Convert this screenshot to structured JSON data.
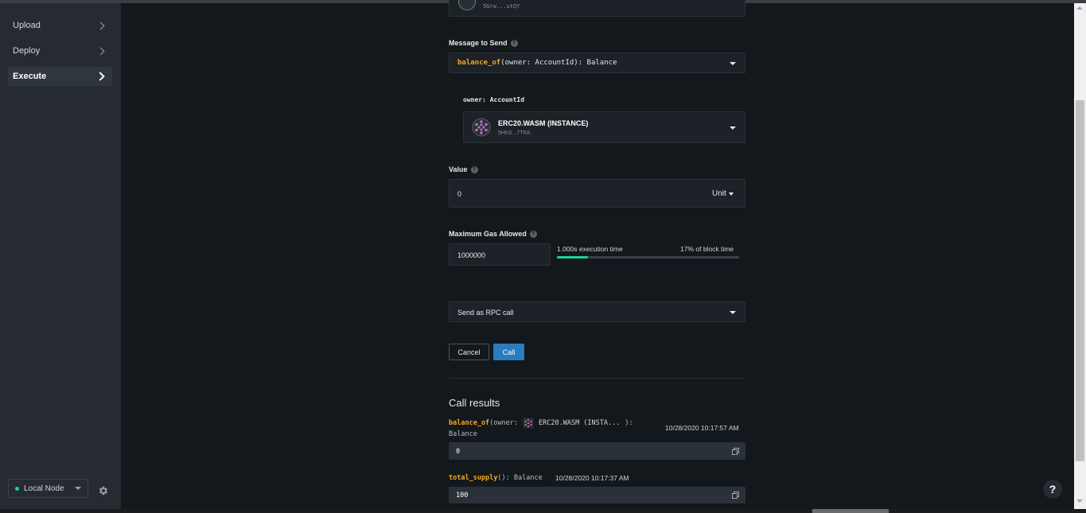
{
  "sidebar": {
    "items": [
      {
        "label": "Upload",
        "active": false
      },
      {
        "label": "Deploy",
        "active": false
      },
      {
        "label": "Execute",
        "active": true
      }
    ],
    "node": {
      "label": "Local Node",
      "status_color": "#1fd29b"
    }
  },
  "caller": {
    "address": "5Grw...utQY"
  },
  "message": {
    "label": "Message to Send",
    "fn_name": "balance_of",
    "signature_rest": "(owner: AccountId): Balance"
  },
  "owner_arg": {
    "label": "owner: AccountId",
    "name": "ERC20.WASM (INSTANCE)",
    "address": "5HhS...7TKK"
  },
  "value_field": {
    "label": "Value",
    "value": "0",
    "unit": "Unit"
  },
  "gas": {
    "label": "Maximum Gas Allowed",
    "value": "1000000",
    "execution_time": "1.000s execution time",
    "block_time": "17% of block time",
    "progress": 0.17,
    "bar_color": "#1fd29b"
  },
  "send_mode": {
    "label": "Send as RPC call"
  },
  "buttons": {
    "cancel": "Cancel",
    "call": "Call"
  },
  "results": {
    "title": "Call results",
    "items": [
      {
        "fn_name": "balance_of",
        "open": "(owner:",
        "arg_name": "ERC20.WASM (INSTA...",
        "close": "):",
        "return_type": "Balance",
        "timestamp": "10/28/2020 10:17:57 AM",
        "output": "0"
      },
      {
        "fn_name": "total_supply",
        "signature_rest": "(): Balance",
        "timestamp": "10/28/2020 10:17:37 AM",
        "output": "100"
      }
    ]
  },
  "help_fab": "?",
  "colors": {
    "accent": "#2b7bc0",
    "fn_highlight": "#f5a623"
  }
}
